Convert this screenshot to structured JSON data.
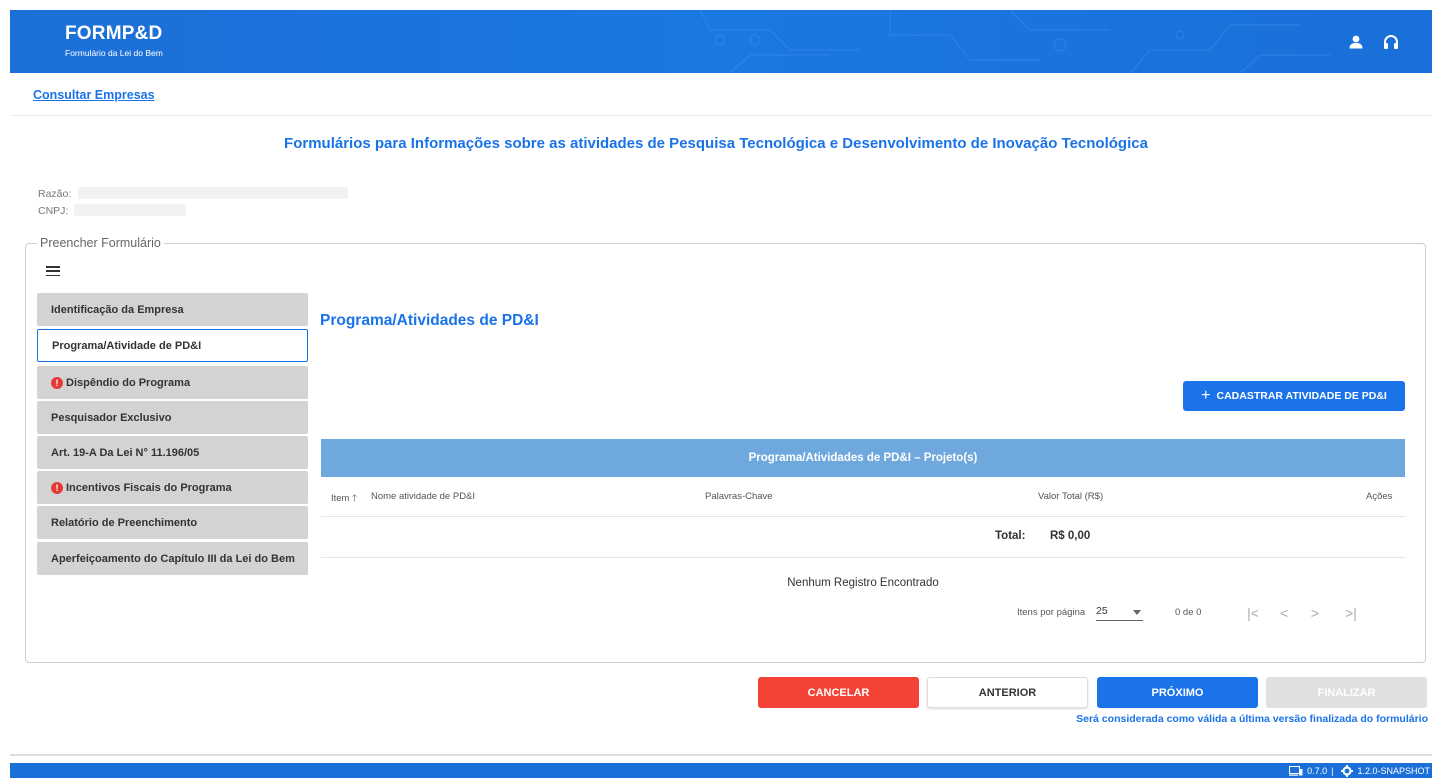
{
  "header": {
    "brand_title": "FORMP&D",
    "brand_subtitle": "Formulário da Lei do Bem"
  },
  "nav": {
    "consult_link": "Consultar Empresas"
  },
  "page": {
    "title": "Formulários para Informações sobre as atividades de Pesquisa Tecnológica e Desenvolvimento de Inovação Tecnológica"
  },
  "company": {
    "razao_label": "Razão:",
    "cnpj_label": "CNPJ:"
  },
  "form": {
    "legend": "Preencher Formulário",
    "sidebar_items": [
      {
        "label": "Identificação da Empresa",
        "error": false,
        "active": false
      },
      {
        "label": "Programa/Atividade de PD&I",
        "error": false,
        "active": true
      },
      {
        "label": "Dispêndio do Programa",
        "error": true,
        "active": false
      },
      {
        "label": "Pesquisador Exclusivo",
        "error": false,
        "active": false
      },
      {
        "label": "Art. 19-A Da Lei N° 11.196/05",
        "error": false,
        "active": false
      },
      {
        "label": "Incentivos Fiscais do Programa",
        "error": true,
        "active": false
      },
      {
        "label": "Relatório de Preenchimento",
        "error": false,
        "active": false
      },
      {
        "label": "Aperfeiçoamento do Capítulo III da Lei do Bem",
        "error": false,
        "active": false
      }
    ],
    "error_glyph": "!"
  },
  "section": {
    "title": "Programa/Atividades de PD&I",
    "add_button": "CADASTRAR ATIVIDADE DE PD&I",
    "add_glyph": "+"
  },
  "table": {
    "header": "Programa/Atividades de PD&I – Projeto(s)",
    "columns": {
      "item": "Item",
      "sort_glyph": "🡑",
      "nome": "Nome atividade de PD&I",
      "palavras": "Palavras-Chave",
      "valor": "Valor Total (R$)",
      "acoes": "Ações"
    },
    "total_label": "Total:",
    "total_value": "R$ 0,00",
    "empty_message": "Nenhum Registro Encontrado"
  },
  "pagination": {
    "items_per_page_label": "Itens por página",
    "items_per_page_value": "25",
    "range": "0 de 0",
    "first": "|<",
    "prev": "<",
    "next": ">",
    "last": ">|"
  },
  "actions": {
    "cancel": "CANCELAR",
    "previous": "ANTERIOR",
    "next": "PRÓXIMO",
    "finish": "FINALIZAR",
    "notice": "Será considerada como válida a última versão finalizada do formulário"
  },
  "footer": {
    "frontend_version": "0.7.0",
    "separator": "|",
    "backend_version": "1.2.0-SNAPSHOT"
  },
  "colors": {
    "primary": "#1a73e8",
    "danger": "#f44336",
    "table_header": "#6fa8dc",
    "nav_bg": "#d3d3d3"
  }
}
